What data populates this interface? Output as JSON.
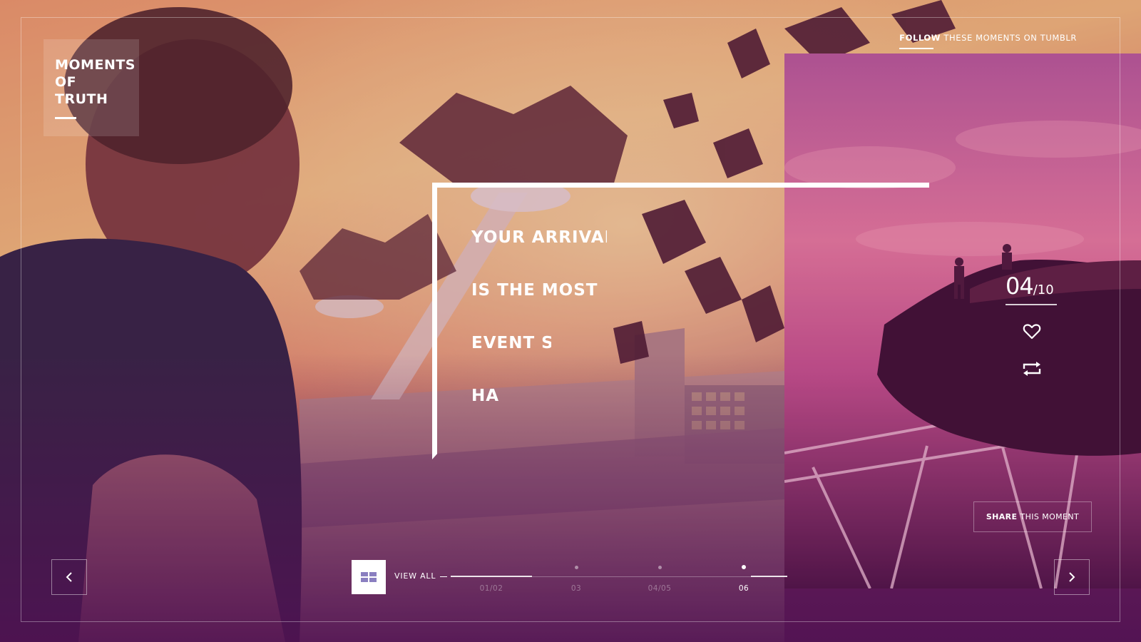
{
  "brand": {
    "lines": [
      "MOMENTS",
      "OF",
      "TRUTH"
    ]
  },
  "follow": {
    "bold": "FOLLOW",
    "rest": "THESE MOMENTS ON TUMBLR"
  },
  "headline": {
    "lines": [
      "YOUR ARRIVAL",
      "IS THE MOST F",
      "EVENT S",
      "HA"
    ]
  },
  "counter": {
    "current": "04",
    "total": "/10"
  },
  "actions": {
    "like_icon": "heart-icon",
    "reblog_icon": "reblog-icon"
  },
  "share": {
    "bold": "SHARE",
    "rest": "THIS MOMENT"
  },
  "nav": {
    "prev_icon": "chevron-left-icon",
    "next_icon": "chevron-right-icon",
    "view_all_icon": "grid-icon",
    "view_all_label": "VIEW ALL"
  },
  "timeline": {
    "items": [
      {
        "label": "01/02",
        "active": false
      },
      {
        "label": "03",
        "active": false
      },
      {
        "label": "04/05",
        "active": false
      },
      {
        "label": "06",
        "active": true
      }
    ]
  },
  "colors": {
    "accent": "#ffffff",
    "overlay": "#5a1656",
    "sky_warm": "#f7b36a",
    "sky_pink": "#e2629a"
  }
}
